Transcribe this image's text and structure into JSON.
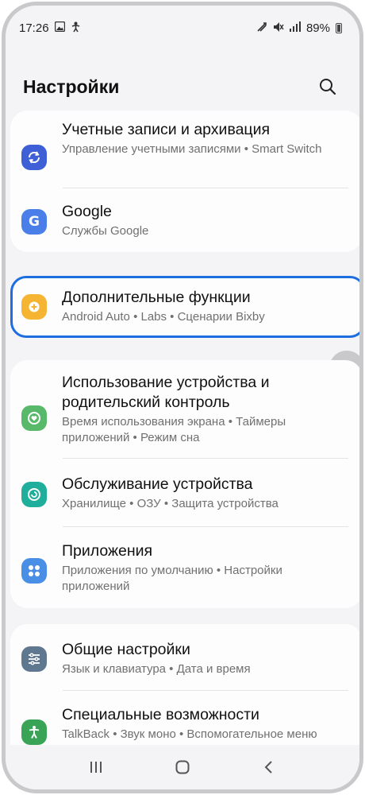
{
  "status_bar": {
    "time": "17:26",
    "battery": "89%",
    "icons_left": [
      "image-icon",
      "accessibility-person-icon"
    ],
    "icons_right": [
      "cast-icon",
      "mute-icon",
      "signal-icon",
      "battery-icon"
    ]
  },
  "header": {
    "title": "Настройки",
    "search_icon": "search-icon"
  },
  "sections": {
    "accounts": {
      "title": "Учетные записи и архивация",
      "subtitle": "Управление учетными записями • Smart Switch",
      "icon": "sync-icon",
      "color": "#3e5fd6"
    },
    "google": {
      "title": "Google",
      "subtitle": "Службы Google",
      "icon": "google-icon",
      "color": "#4a7ee8"
    },
    "advanced": {
      "title": "Дополнительные функции",
      "subtitle": "Android Auto • Labs • Сценарии Bixby",
      "icon": "plus-gear-icon",
      "color": "#f5b533"
    },
    "wellbeing": {
      "title": "Использование устройства и родительский контроль",
      "subtitle": "Время использования экрана • Таймеры приложений • Режим сна",
      "icon": "heart-ring-icon",
      "color": "#58b96a"
    },
    "device_care": {
      "title": "Обслуживание устройства",
      "subtitle": "Хранилище • ОЗУ • Защита устройства",
      "icon": "refresh-ring-icon",
      "color": "#1fae9b"
    },
    "apps": {
      "title": "Приложения",
      "subtitle": "Приложения по умолчанию • Настройки приложений",
      "icon": "apps-grid-icon",
      "color": "#4a8fe6"
    },
    "general": {
      "title": "Общие настройки",
      "subtitle": "Язык и клавиатура • Дата и время",
      "icon": "sliders-icon",
      "color": "#5f7890"
    },
    "accessibility": {
      "title": "Специальные возможности",
      "subtitle": "TalkBack • Звук моно • Вспомогательное меню",
      "icon": "accessibility-icon",
      "color": "#3aa456"
    }
  },
  "fab": {
    "icon": "edit-pencil-icon"
  },
  "nav": {
    "recent_icon": "recent-apps-icon",
    "home_icon": "home-icon",
    "back_icon": "back-icon"
  },
  "accent_highlight_color": "#1d6fe0"
}
